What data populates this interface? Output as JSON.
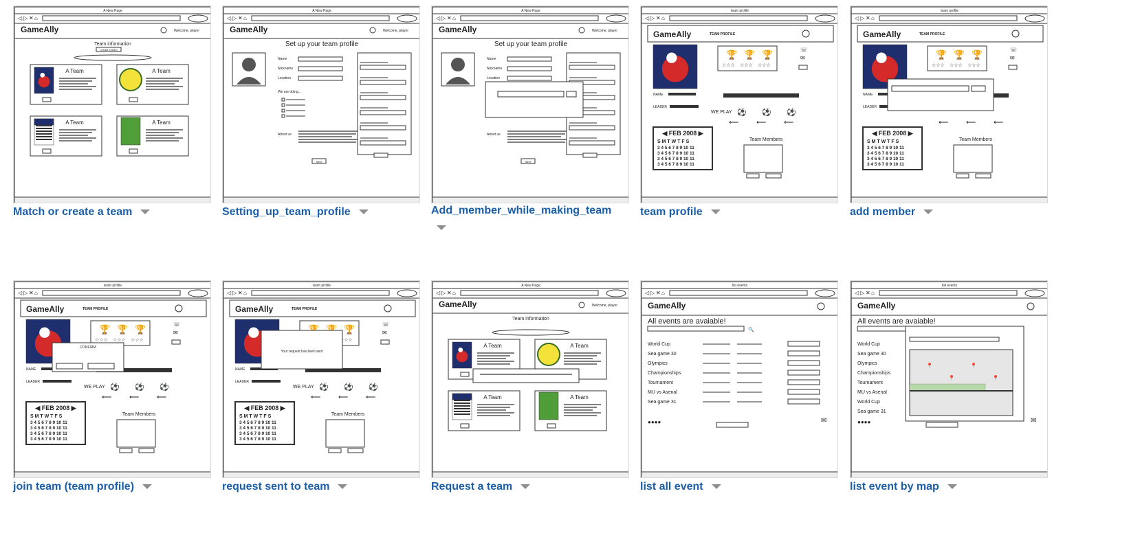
{
  "cards": [
    {
      "label": "Match or create a team",
      "thumb": {
        "url": "A New Page",
        "brand": "GameAlly",
        "welcome": "Welcome, player",
        "heading": "Team information",
        "button": "Create a team",
        "team": "A Team"
      }
    },
    {
      "label": "Setting_up_team_profile",
      "thumb": {
        "url": "A New Page",
        "brand": "GameAlly",
        "welcome": "Welcome, player",
        "heading": "Set up your team profile",
        "button": "Save"
      }
    },
    {
      "label": "Add_member_while_making_team",
      "thumb": {
        "url": "A New Page",
        "brand": "GameAlly",
        "welcome": "Welcome, player",
        "heading": "Set up your team profile",
        "button": "Save"
      }
    },
    {
      "label": "team profile",
      "thumb": {
        "url": "team profile",
        "brand": "GameAlly",
        "section": "TEAM PROFILE",
        "calendar": "FEB 2008",
        "members": "Team Members",
        "weplay": "WE PLAY"
      }
    },
    {
      "label": "add member",
      "thumb": {
        "url": "team profile",
        "brand": "GameAlly",
        "section": "TEAM PROFILE",
        "calendar": "FEB 2008",
        "members": "Team Members"
      }
    },
    {
      "label": "join team (team profile)",
      "thumb": {
        "url": "team profile",
        "brand": "GameAlly",
        "section": "TEAM PROFILE",
        "calendar": "FEB 2008",
        "members": "Team Members",
        "weplay": "WE PLAY",
        "dialog_title": "CONFIRM"
      }
    },
    {
      "label": "request sent to team",
      "thumb": {
        "url": "team profile",
        "brand": "GameAlly",
        "section": "TEAM PROFILE",
        "calendar": "FEB 2008",
        "members": "Team Members",
        "weplay": "WE PLAY",
        "dialog_text": "Your request has been sent"
      }
    },
    {
      "label": "Request a team",
      "thumb": {
        "url": "A New Page",
        "brand": "GameAlly",
        "welcome": "Welcome, player",
        "heading": "Team information",
        "team": "A Team"
      }
    },
    {
      "label": "list all event",
      "thumb": {
        "url": "list events",
        "brand": "GameAlly",
        "heading": "All events are avaiable!",
        "events": [
          "World Cup",
          "Sea game 30",
          "Olympics",
          "Championships",
          "Tournament",
          "MU vs Asenal",
          "Sea game 31"
        ]
      }
    },
    {
      "label": "list event by map",
      "thumb": {
        "url": "list events",
        "brand": "GameAlly",
        "heading": "All events are avaiable!",
        "events": [
          "World Cup",
          "Sea game 30",
          "Olympics",
          "Championships",
          "Tournament",
          "MU vs Asenal",
          "World Cup",
          "Sea game 31"
        ]
      }
    }
  ],
  "colors": {
    "caption": "#1a5fa8",
    "caret": "#8f8f8f",
    "sketch": "#333333",
    "rooster_bg": "#1f2f6e",
    "rooster_red": "#d42a2a",
    "pitch_green": "#4f9e3a"
  }
}
